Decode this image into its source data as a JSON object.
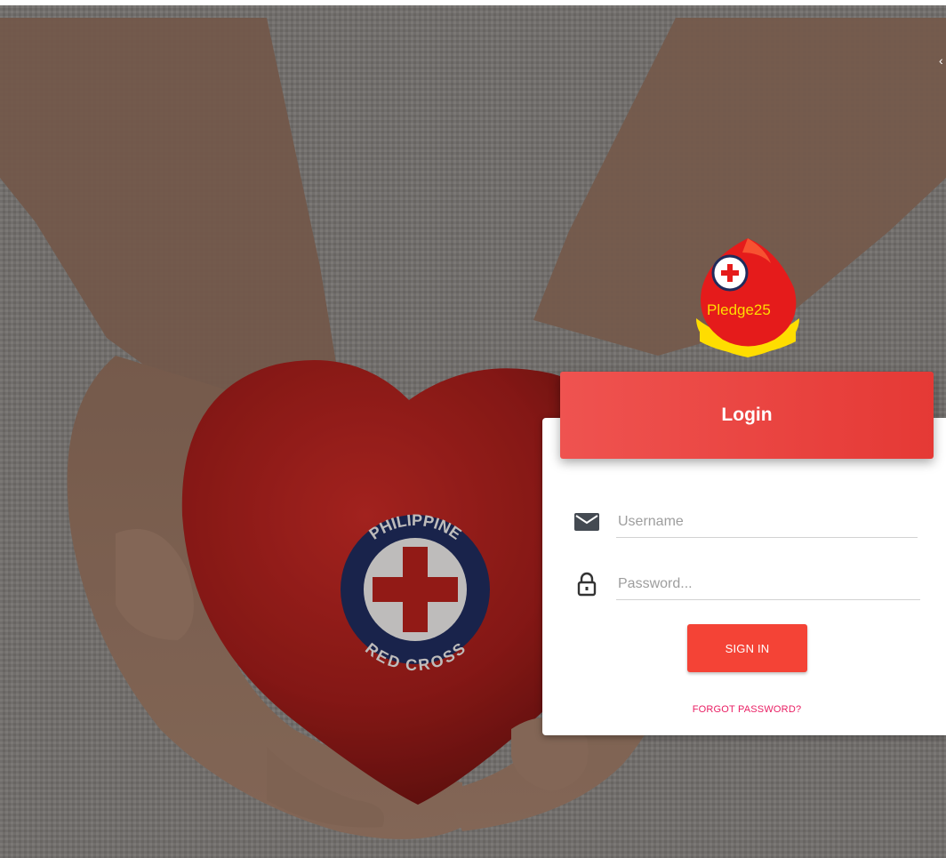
{
  "card": {
    "title": "Login",
    "username_placeholder": "Username",
    "password_placeholder": "Password...",
    "signin_label": "SIGN IN",
    "forgot_label": "FORGOT PASSWORD?"
  },
  "logo": {
    "text": "Pledge25",
    "emblem": "red-cross-emblem"
  },
  "background": {
    "emblem_top_text": "PHILIPPINE",
    "emblem_bottom_text": "RED CROSS"
  },
  "icons": {
    "username": "envelope-icon",
    "password": "lock-icon"
  },
  "colors": {
    "primary": "#f44336",
    "header_gradient_start": "#ef5350",
    "header_gradient_end": "#e53935",
    "link": "#e91e63",
    "heart": "#b3201c",
    "emblem_navy": "#1f2b5c",
    "logo_yellow": "#ffdd00"
  }
}
